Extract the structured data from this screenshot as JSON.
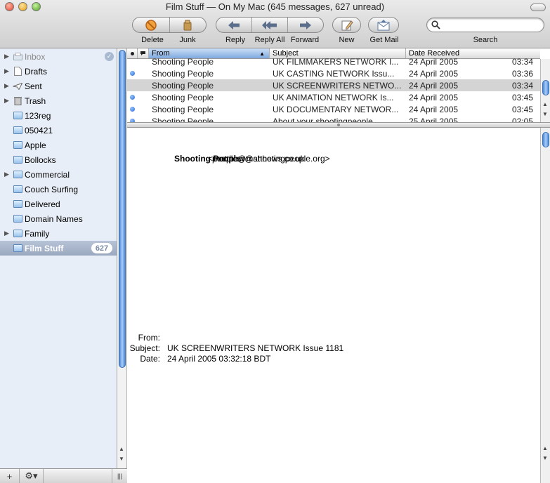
{
  "window": {
    "title": "Film Stuff — On My Mac (645 messages, 627 unread)"
  },
  "toolbar": {
    "delete_label": "Delete",
    "junk_label": "Junk",
    "reply_label": "Reply",
    "reply_all_label": "Reply All",
    "forward_label": "Forward",
    "new_label": "New",
    "get_mail_label": "Get Mail",
    "search_label": "Search",
    "search_value": ""
  },
  "sidebar": {
    "mailboxes": [
      {
        "label": "Inbox",
        "icon": "inbox-icon",
        "disclosure": true,
        "dim": true
      },
      {
        "label": "Drafts",
        "icon": "drafts-icon",
        "disclosure": true
      },
      {
        "label": "Sent",
        "icon": "sent-icon",
        "disclosure": true
      },
      {
        "label": "Trash",
        "icon": "trash-icon",
        "disclosure": true
      },
      {
        "label": "123reg",
        "icon": "folder-icon"
      },
      {
        "label": "050421",
        "icon": "folder-icon"
      },
      {
        "label": "Apple",
        "icon": "folder-icon"
      },
      {
        "label": "Bollocks",
        "icon": "folder-icon"
      },
      {
        "label": "Commercial",
        "icon": "folder-icon",
        "disclosure": true
      },
      {
        "label": "Couch Surfing",
        "icon": "folder-icon"
      },
      {
        "label": "Delivered",
        "icon": "folder-icon"
      },
      {
        "label": "Domain Names",
        "icon": "folder-icon"
      },
      {
        "label": "Family",
        "icon": "folder-icon",
        "disclosure": true
      },
      {
        "label": "Film Stuff",
        "icon": "folder-icon",
        "selected": true,
        "badge": "627"
      }
    ]
  },
  "list": {
    "columns": {
      "from": "From",
      "subject": "Subject",
      "date": "Date Received"
    },
    "rows": [
      {
        "unread": false,
        "from": "Shooting People",
        "subject": "UK FILMMAKERS NETWORK I...",
        "date": "24 April 2005",
        "time": "03:34"
      },
      {
        "unread": true,
        "from": "Shooting People",
        "subject": "UK CASTING NETWORK Issu...",
        "date": "24 April 2005",
        "time": "03:36"
      },
      {
        "unread": false,
        "from": "Shooting People",
        "subject": "UK SCREENWRITERS NETWO...",
        "date": "24 April 2005",
        "time": "03:34",
        "selected": true
      },
      {
        "unread": true,
        "from": "Shooting People",
        "subject": "UK ANIMATION NETWORK Is...",
        "date": "24 April 2005",
        "time": "03:45"
      },
      {
        "unread": true,
        "from": "Shooting People",
        "subject": "UK DOCUMENTARY NETWOR...",
        "date": "24 April 2005",
        "time": "03:45"
      },
      {
        "unread": true,
        "from": "Shooting People",
        "subject": "About your shootingpeople",
        "date": "25 April 2005",
        "time": "02:05"
      }
    ]
  },
  "preview": {
    "overlap_a": "Shooting People",
    "overlap_b": "<matthew@shootingpeople.org>",
    "overlap_c": "people@matthews.co.uk",
    "from_key": "From:",
    "from_val": "",
    "subject_key": "Subject:",
    "subject_val": "UK SCREENWRITERS NETWORK Issue 1181",
    "date_key": "Date:",
    "date_val": "24 April 2005 03:32:18 BDT"
  },
  "bottom": {
    "add": "+",
    "action": "⚙▾",
    "grip": "|||"
  }
}
